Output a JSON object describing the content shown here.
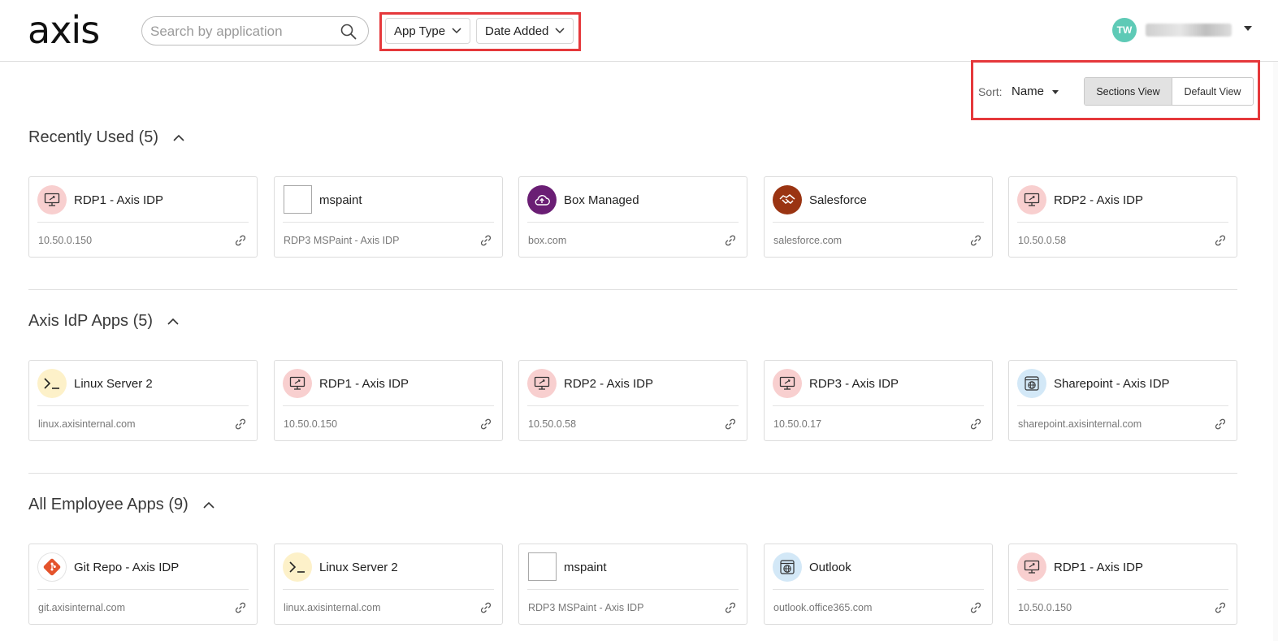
{
  "header": {
    "logo": "axis",
    "search_placeholder": "Search by application",
    "filters": [
      "App Type",
      "Date Added"
    ],
    "user_initials": "TW",
    "avatar_color": "#5ecab6",
    "highlight_color": "#e5383b"
  },
  "sort": {
    "label": "Sort:",
    "value": "Name",
    "views": [
      "Sections View",
      "Default View"
    ],
    "active_view": "Sections View"
  },
  "sections": [
    {
      "title": "Recently Used (5)",
      "cards": [
        {
          "name": "RDP1 - Axis IDP",
          "url": "10.50.0.150",
          "icon": "rdp-monitor-icon"
        },
        {
          "name": "mspaint",
          "url": "RDP3 MSPaint - Axis IDP",
          "icon": "broken-image-icon"
        },
        {
          "name": "Box Managed",
          "url": "box.com",
          "icon": "cloud-upload-icon"
        },
        {
          "name": "Salesforce",
          "url": "salesforce.com",
          "icon": "handshake-icon"
        },
        {
          "name": "RDP2 - Axis IDP",
          "url": "10.50.0.58",
          "icon": "rdp-monitor-icon"
        }
      ]
    },
    {
      "title": "Axis IdP Apps (5)",
      "cards": [
        {
          "name": "Linux Server 2",
          "url": "linux.axisinternal.com",
          "icon": "terminal-icon"
        },
        {
          "name": "RDP1 - Axis IDP",
          "url": "10.50.0.150",
          "icon": "rdp-monitor-icon"
        },
        {
          "name": "RDP2 - Axis IDP",
          "url": "10.50.0.58",
          "icon": "rdp-monitor-icon"
        },
        {
          "name": "RDP3 - Axis IDP",
          "url": "10.50.0.17",
          "icon": "rdp-monitor-icon"
        },
        {
          "name": "Sharepoint - Axis IDP",
          "url": "sharepoint.axisinternal.com",
          "icon": "web-globe-icon"
        }
      ]
    },
    {
      "title": "All Employee Apps (9)",
      "cards": [
        {
          "name": "Git Repo - Axis IDP",
          "url": "git.axisinternal.com",
          "icon": "git-icon"
        },
        {
          "name": "Linux Server 2",
          "url": "linux.axisinternal.com",
          "icon": "terminal-icon"
        },
        {
          "name": "mspaint",
          "url": "RDP3 MSPaint - Axis IDP",
          "icon": "broken-image-icon"
        },
        {
          "name": "Outlook",
          "url": "outlook.office365.com",
          "icon": "web-globe-icon"
        },
        {
          "name": "RDP1 - Axis IDP",
          "url": "10.50.0.150",
          "icon": "rdp-monitor-icon"
        }
      ]
    }
  ]
}
